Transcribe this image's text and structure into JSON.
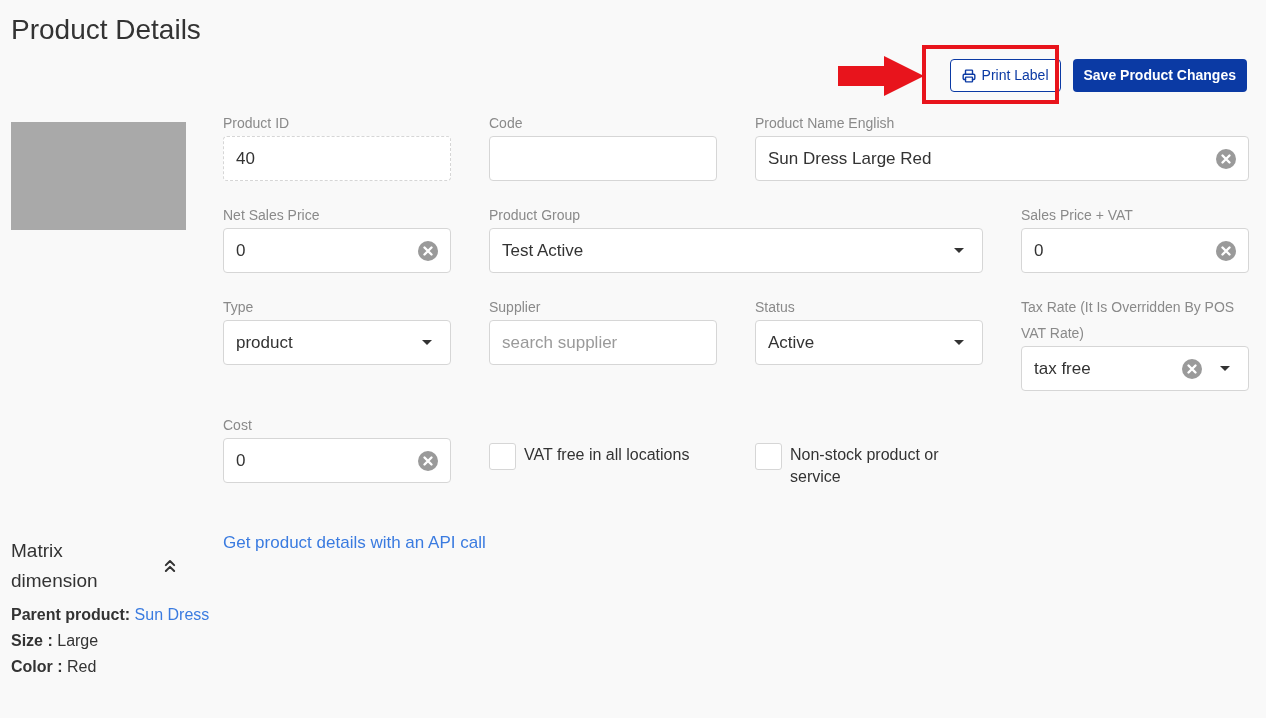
{
  "title": "Product Details",
  "actions": {
    "print_label": "Print Label",
    "save": "Save Product Changes"
  },
  "annotation": {
    "highlight": true
  },
  "rows": [
    [
      {
        "kind": "text",
        "label": "Product ID",
        "value": "40",
        "readonly": true
      },
      {
        "kind": "text",
        "label": "Code"
      },
      {
        "kind": "text",
        "label": "Product Name English",
        "value": "Sun Dress Large Red",
        "clearable": true
      }
    ],
    [
      {
        "kind": "text",
        "label": "Net Sales Price",
        "value": "0",
        "clearable": true
      },
      {
        "kind": "select",
        "label": "Product Group",
        "value": "Test Active"
      },
      {
        "kind": "text",
        "label": "Sales Price + VAT",
        "value": "0",
        "clearable": true
      }
    ],
    [
      {
        "kind": "select",
        "label": "Type",
        "value": "product"
      },
      {
        "kind": "text",
        "label": "Supplier",
        "placeholder": "search supplier"
      },
      {
        "kind": "select",
        "label": "Status",
        "value": "Active"
      },
      {
        "kind": "select",
        "label": "Tax Rate (It Is Overridden By POS VAT Rate)",
        "value": "tax free",
        "clearable": true
      }
    ],
    [
      {
        "kind": "text",
        "label": "Cost",
        "value": "0",
        "clearable": true
      },
      {
        "kind": "checkbox",
        "label": "VAT free in all locations",
        "checked": false
      },
      {
        "kind": "checkbox",
        "label": "Non-stock product or service",
        "checked": false
      }
    ]
  ],
  "api_link": "Get product details with an API call",
  "matrix": {
    "title": "Matrix dimension",
    "expanded": true,
    "parent_label": "Parent product:",
    "parent_link": "Sun Dress",
    "attributes": [
      "**Size :** Large",
      "**Color :** Red"
    ]
  }
}
